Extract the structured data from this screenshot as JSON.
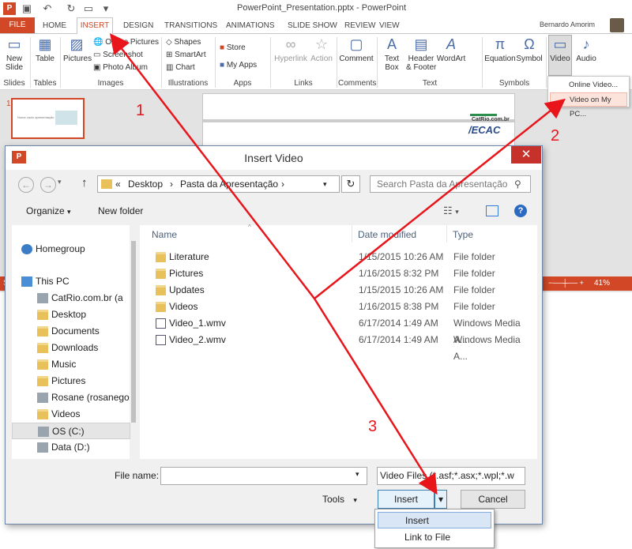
{
  "ppt": {
    "window_title": "PowerPoint_Presentation.pptx - PowerPoint",
    "user": "Bernardo Amorim",
    "tabs": [
      "FILE",
      "HOME",
      "INSERT",
      "DESIGN",
      "TRANSITIONS",
      "ANIMATIONS",
      "SLIDE SHOW",
      "REVIEW",
      "VIEW"
    ],
    "ribbon": {
      "new_slide": "New\nSlide",
      "table": "Table",
      "pictures": "Pictures",
      "online_pictures": "Online Pictures",
      "screenshot": "Screenshot",
      "photo_album": "Photo Album",
      "shapes": "Shapes",
      "smartart": "SmartArt",
      "chart": "Chart",
      "store": "Store",
      "my_apps": "My Apps",
      "hyperlink": "Hyperlink",
      "action": "Action",
      "comment": "Comment",
      "text_box": "Text\nBox",
      "header_footer": "Header\n& Footer",
      "wordart": "WordArt",
      "equation": "Equation",
      "symbol": "Symbol",
      "video": "Video",
      "audio": "Audio",
      "groups": [
        "Slides",
        "Tables",
        "Images",
        "Illustrations",
        "Apps",
        "Links",
        "Comments",
        "Text",
        "Symbols"
      ]
    },
    "video_menu": [
      "Online Video...",
      "Video on My PC..."
    ],
    "slide_number": "1",
    "zoom": "41%",
    "slide_logo": "CatRio.com.br",
    "slide_logo2": "/ECAC",
    "thumb_text": "Nome vazio apresentação"
  },
  "dialog": {
    "title": "Insert Video",
    "breadcrumb": [
      "Desktop",
      "Pasta da Apresentação"
    ],
    "search_placeholder": "Search Pasta da Apresentação",
    "organize": "Organize",
    "new_folder": "New folder",
    "nav": [
      {
        "label": "Homegroup",
        "icon": "homegroup-icon"
      },
      {
        "label": "This PC",
        "icon": "computer-icon"
      },
      {
        "label": "CatRio.com.br (a",
        "icon": "network-drive-icon"
      },
      {
        "label": "Desktop",
        "icon": "folder-icon"
      },
      {
        "label": "Documents",
        "icon": "folder-icon"
      },
      {
        "label": "Downloads",
        "icon": "folder-icon"
      },
      {
        "label": "Music",
        "icon": "folder-icon"
      },
      {
        "label": "Pictures",
        "icon": "folder-icon"
      },
      {
        "label": "Rosane (rosanego",
        "icon": "network-drive-icon"
      },
      {
        "label": "Videos",
        "icon": "folder-icon"
      },
      {
        "label": "OS (C:)",
        "icon": "drive-icon"
      },
      {
        "label": "Data (D:)",
        "icon": "drive-icon"
      }
    ],
    "columns": [
      "Name",
      "Date modified",
      "Type"
    ],
    "files": [
      {
        "name": "Literature",
        "date": "1/15/2015 10:26 AM",
        "type": "File folder",
        "icon": "folder-icon"
      },
      {
        "name": "Pictures",
        "date": "1/16/2015 8:32 PM",
        "type": "File folder",
        "icon": "folder-icon"
      },
      {
        "name": "Updates",
        "date": "1/15/2015 10:26 AM",
        "type": "File folder",
        "icon": "folder-icon"
      },
      {
        "name": "Videos",
        "date": "1/16/2015 8:38 PM",
        "type": "File folder",
        "icon": "folder-icon"
      },
      {
        "name": "Video_1.wmv",
        "date": "6/17/2014 1:49 AM",
        "type": "Windows Media A...",
        "icon": "video-file-icon"
      },
      {
        "name": "Video_2.wmv",
        "date": "6/17/2014 1:49 AM",
        "type": "Windows Media A...",
        "icon": "video-file-icon"
      }
    ],
    "file_name_label": "File name:",
    "file_name_value": "",
    "file_type": "Video Files (*.asf;*.asx;*.wpl;*.w",
    "tools": "Tools",
    "insert": "Insert",
    "cancel": "Cancel",
    "insert_menu": [
      "Insert",
      "Link to File"
    ]
  },
  "annotations": {
    "labels": [
      "1",
      "2",
      "3"
    ],
    "color": "#e8151b"
  }
}
